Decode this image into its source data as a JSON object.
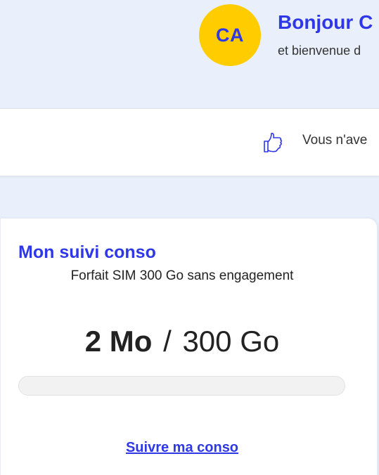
{
  "header": {
    "avatar_initials": "CA",
    "greeting_title": "Bonjour C",
    "greeting_subtitle": "et bienvenue d"
  },
  "banner": {
    "icon": "thumbs-up-icon",
    "text": "Vous n'ave"
  },
  "consumption_card": {
    "title": "Mon suivi conso",
    "plan": "Forfait SIM 300 Go sans engagement",
    "used": "2 Mo",
    "separator": "/",
    "total": "300 Go",
    "progress_fraction": 6.7e-06,
    "link_label": "Suivre ma conso"
  },
  "colors": {
    "accent": "#2f38e6",
    "avatar_bg": "#ffcc00",
    "page_bg": "#eaf0fb"
  }
}
